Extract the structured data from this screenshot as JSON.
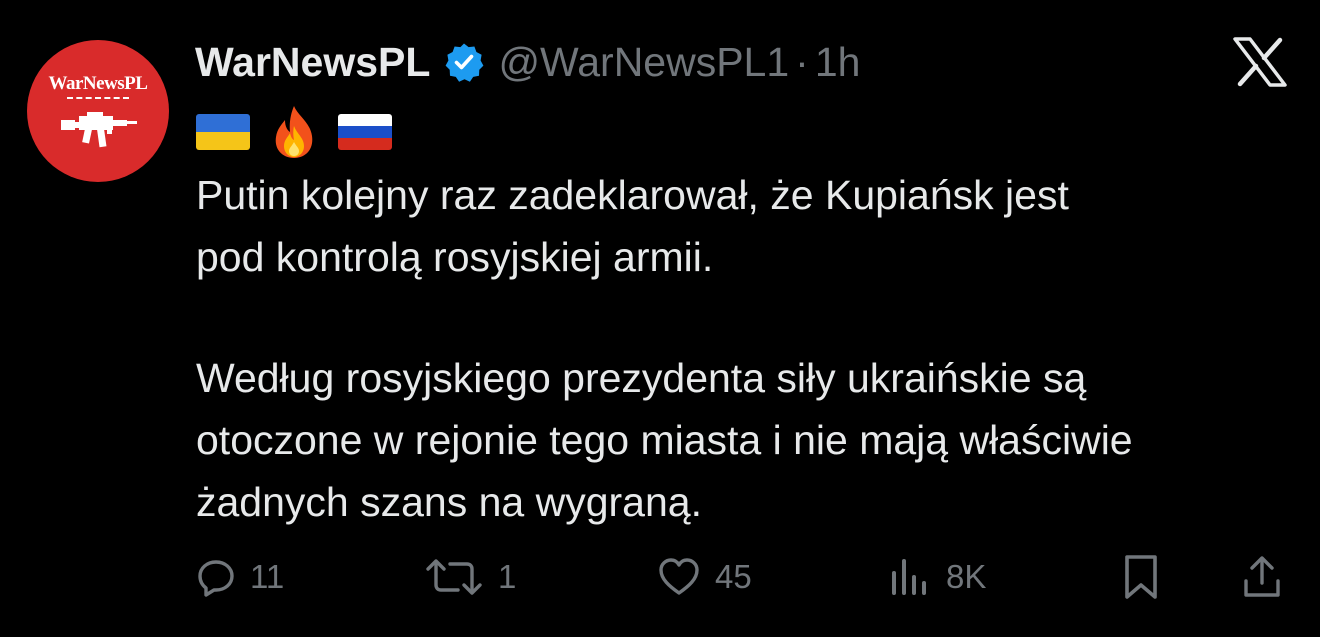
{
  "author": {
    "name": "WarNewsPL",
    "handle": "@WarNewsPL1",
    "separator": "·",
    "time": "1h",
    "avatar_text": "WarNewsPL",
    "avatar_color": "#d92b2b",
    "verified_icon": "verified-badge-icon"
  },
  "flags": [
    "ukraine-flag-icon",
    "fire-icon",
    "russia-flag-icon"
  ],
  "tweet": {
    "paragraph1": "Putin kolejny raz zadeklarował, że Kupiańsk jest\npod kontrolą rosyjskiej armii.",
    "paragraph2": "Według rosyjskiego prezydenta siły ukraińskie są\notoczone w rejonie tego miasta i nie mają właściwie\nżadnych szans na wygraną."
  },
  "actions": {
    "replies": "11",
    "reposts": "1",
    "likes": "45",
    "views": "8K"
  },
  "colors": {
    "background": "#000000",
    "text": "#e7e9ea",
    "muted": "#71767b",
    "verified": "#1d9bf0"
  }
}
